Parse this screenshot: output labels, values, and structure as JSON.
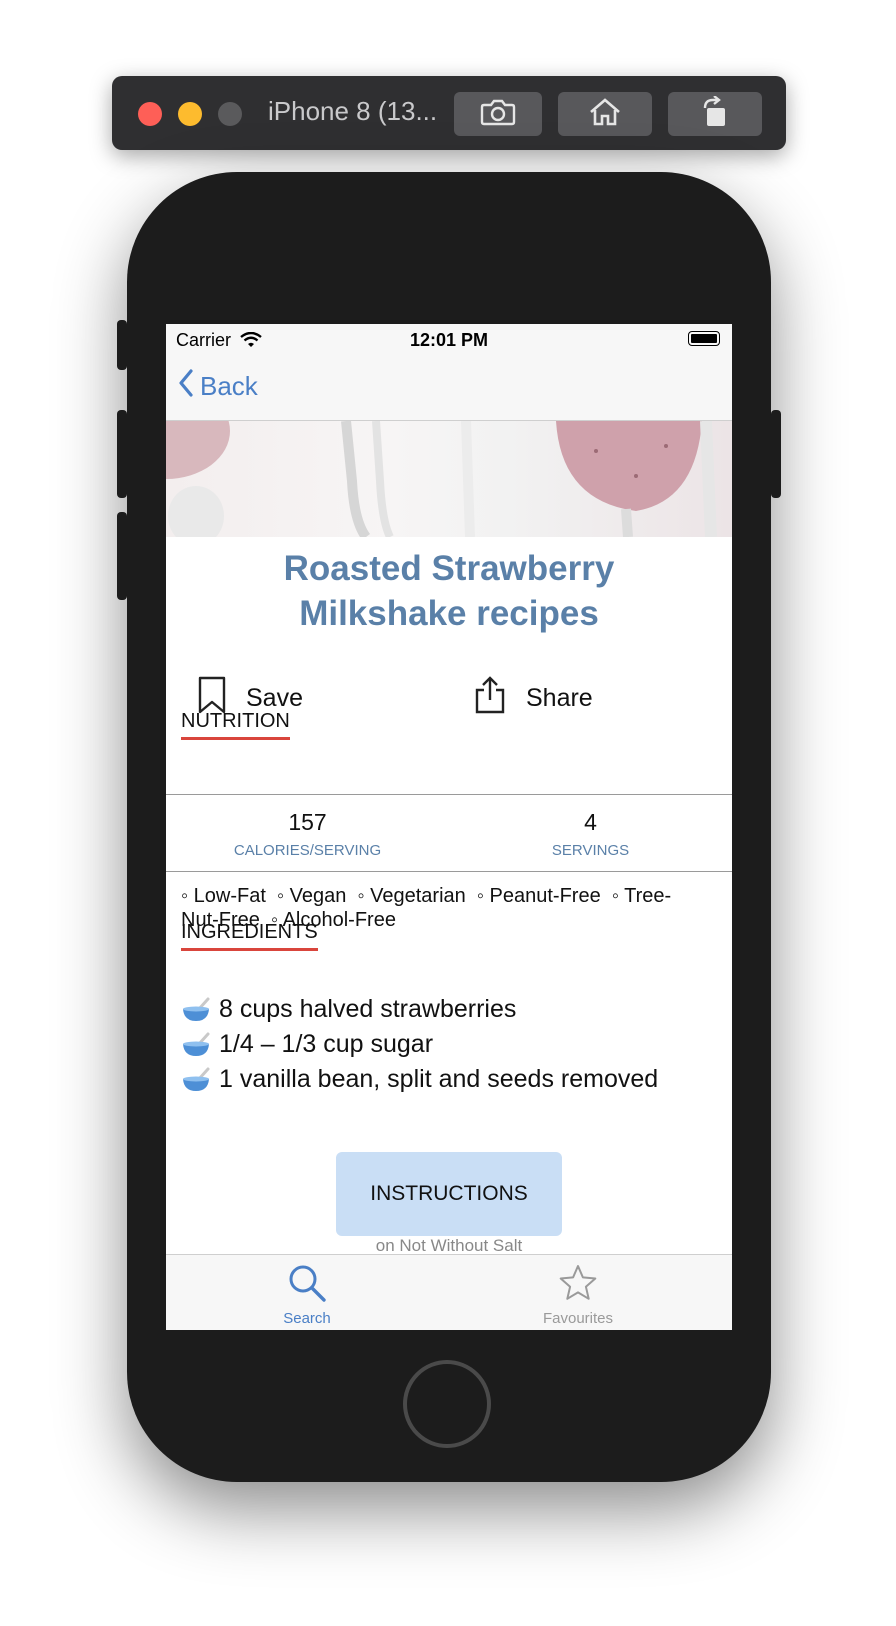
{
  "simulator": {
    "title": "iPhone 8 (13..."
  },
  "status_bar": {
    "carrier": "Carrier",
    "time": "12:01 PM"
  },
  "nav": {
    "back_label": "Back"
  },
  "recipe": {
    "title_line1": "Roasted Strawberry",
    "title_line2": "Milkshake recipes"
  },
  "actions": {
    "save_label": "Save",
    "share_label": "Share"
  },
  "nutrition": {
    "heading": "NUTRITION",
    "calories_value": "157",
    "calories_label": "CALORIES/SERVING",
    "servings_value": "4",
    "servings_label": "SERVINGS"
  },
  "health_labels": {
    "line1": "◦ Low-Fat  ◦ Vegan  ◦ Vegetarian  ◦ Peanut-Free  ◦ Tree-",
    "line2": "Nut-Free  ◦ Alcohol-Free"
  },
  "ingredients": {
    "heading": "INGREDIENTS",
    "items": [
      "8 cups halved strawberries",
      "1/4 – 1/3 cup sugar",
      "1 vanilla bean, split and seeds removed"
    ]
  },
  "instructions": {
    "button_label": "INSTRUCTIONS",
    "source": "on Not Without Salt"
  },
  "tabs": [
    {
      "label": "Search",
      "active": true
    },
    {
      "label": "Favourites",
      "active": false
    }
  ],
  "colors": {
    "accent": "#4a7fc6",
    "title": "#5a80a8",
    "underline": "#d9453c",
    "instructions_bg": "#c9def5",
    "tab_inactive": "#9a9a9a"
  }
}
